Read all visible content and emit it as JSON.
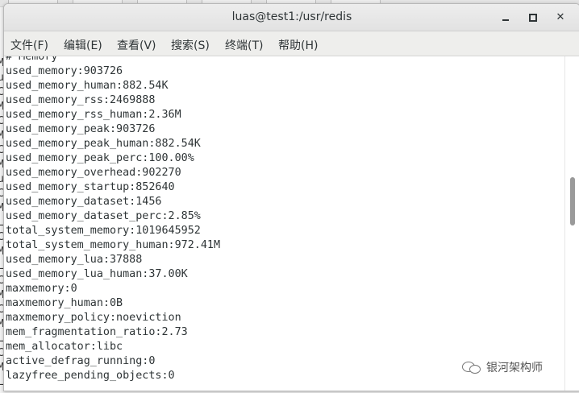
{
  "window": {
    "title": "luas@test1:/usr/redis",
    "minimize_icon": "minimize-icon",
    "maximize_icon": "maximize-icon",
    "close_icon": "close-icon",
    "close_glyph": "✕"
  },
  "menubar": {
    "items": [
      {
        "label": "文件(F)"
      },
      {
        "label": "编辑(E)"
      },
      {
        "label": "查看(V)"
      },
      {
        "label": "搜索(S)"
      },
      {
        "label": "终端(T)"
      },
      {
        "label": "帮助(H)"
      }
    ]
  },
  "terminal": {
    "lines": [
      "# Memory",
      "used_memory:903726",
      "used_memory_human:882.54K",
      "used_memory_rss:2469888",
      "used_memory_rss_human:2.36M",
      "used_memory_peak:903726",
      "used_memory_peak_human:882.54K",
      "used_memory_peak_perc:100.00%",
      "used_memory_overhead:902270",
      "used_memory_startup:852640",
      "used_memory_dataset:1456",
      "used_memory_dataset_perc:2.85%",
      "total_system_memory:1019645952",
      "total_system_memory_human:972.41M",
      "used_memory_lua:37888",
      "used_memory_lua_human:37.00K",
      "maxmemory:0",
      "maxmemory_human:0B",
      "maxmemory_policy:noeviction",
      "mem_fragmentation_ratio:2.73",
      "mem_allocator:libc",
      "active_defrag_running:0",
      "lazyfree_pending_objects:0"
    ]
  },
  "background_gutter": {
    "glyphs": [
      "M",
      "u",
      "C",
      "M",
      "C",
      "M",
      "C",
      "M",
      "u",
      "C",
      "M",
      "L",
      "C",
      "M",
      "L",
      "C",
      "M",
      "C",
      "M",
      "L",
      "C",
      "M",
      "L"
    ]
  },
  "watermark": {
    "label": "银河架构师",
    "icon": "wechat-icon"
  },
  "colors": {
    "terminal_bg": "#ffffff",
    "terminal_fg": "#2e3436",
    "titlebar_bg": "#e6e6e6",
    "menubar_bg": "#eeeeec"
  }
}
